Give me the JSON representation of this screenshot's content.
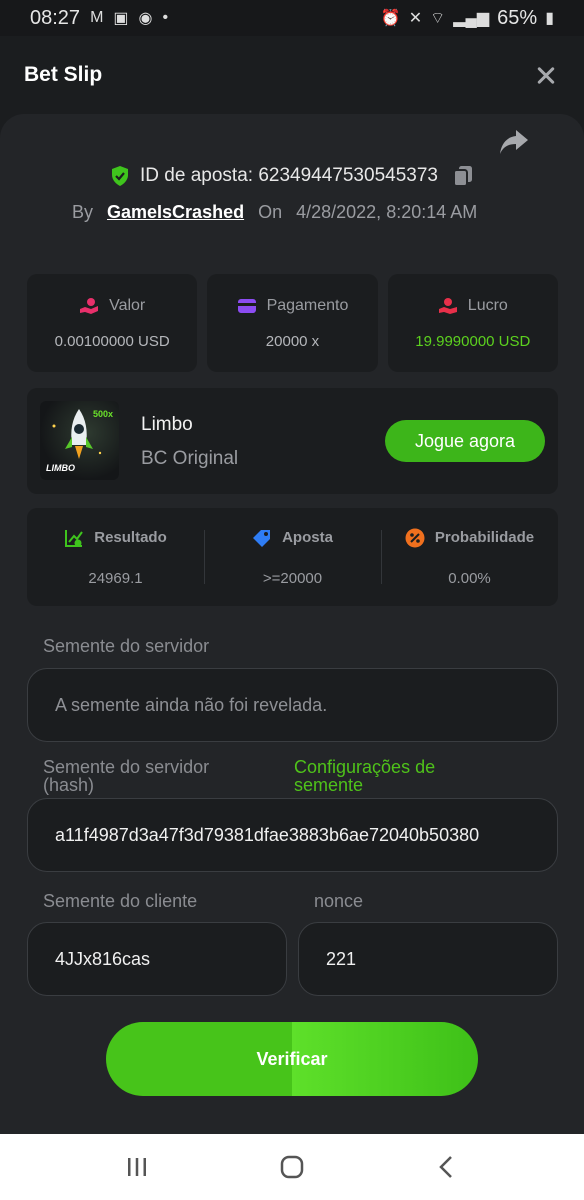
{
  "status_bar": {
    "time": "08:27",
    "battery": "65%",
    "notif_icons": [
      "gmail-icon",
      "photo-icon",
      "messenger-icon",
      "dot-icon"
    ],
    "sys_icons": [
      "alarm-icon",
      "mute-icon",
      "wifi-icon",
      "signal-icon",
      "battery-icon"
    ]
  },
  "header": {
    "title": "Bet Slip"
  },
  "bet": {
    "id_label": "ID de aposta: 623494475305453​73",
    "by_label": "By",
    "user": "GameIsCrashed",
    "on_label": "On",
    "date": "4/28/2022, 8:20:14 AM"
  },
  "stats": [
    {
      "label": "Valor",
      "value": "0.00100000 USD",
      "icon": "money-hand-icon"
    },
    {
      "label": "Pagamento",
      "value": "20000 x",
      "icon": "card-icon"
    },
    {
      "label": "Lucro",
      "value": "19.9990000 USD",
      "icon": "profit-hand-icon"
    }
  ],
  "game": {
    "name": "Limbo",
    "sub": "BC Original",
    "thumb_text": "LIMBO",
    "thumb_badge": "500x",
    "play_label": "Jogue agora"
  },
  "result": [
    {
      "label": "Resultado",
      "value": "24969.1"
    },
    {
      "label": "Aposta",
      "value": ">=20000"
    },
    {
      "label": "Probabilidade",
      "value": "0.00%"
    }
  ],
  "seeds": {
    "server_label": "Semente do servidor",
    "server_value": "A semente ainda não foi revelada.",
    "hash_label": "Semente do servidor (hash)",
    "settings_link": "Configurações de semente",
    "hash_value": "a11f4987d3a47f3d79381dfae3883b6ae72040b50380",
    "client_label": "Semente do cliente",
    "client_value": "4JJx816cas",
    "nonce_label": "nonce",
    "nonce_value": "221"
  },
  "verify_label": "Verificar",
  "colors": {
    "accent": "#3db51a",
    "profit": "#5cd11f",
    "card_bg": "#232528"
  }
}
